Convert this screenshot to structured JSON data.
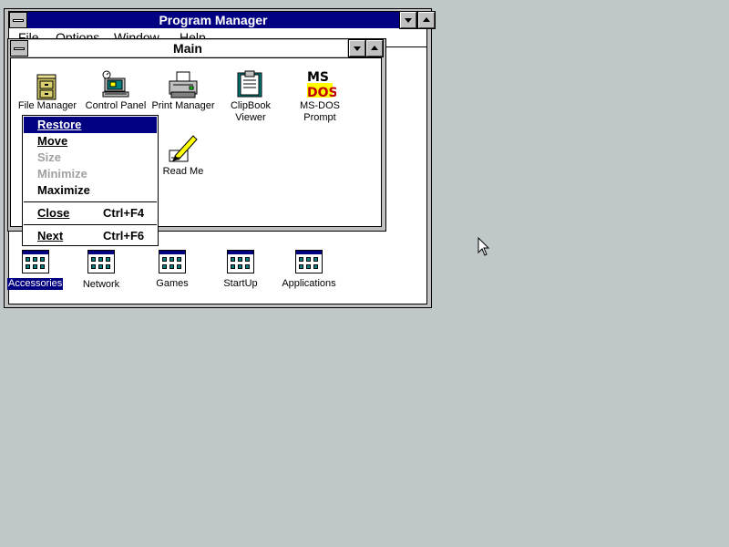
{
  "program_manager": {
    "title": "Program Manager",
    "menu": [
      "File",
      "Options",
      "Window",
      "Help"
    ]
  },
  "main_group": {
    "title": "Main",
    "icons": [
      {
        "label": "File Manager",
        "icon": "file-cabinet-icon"
      },
      {
        "label": "Control Panel",
        "icon": "control-panel-icon"
      },
      {
        "label": "Print Manager",
        "icon": "printer-icon"
      },
      {
        "label_line1": "ClipBook",
        "label_line2": "Viewer",
        "icon": "clipbook-icon"
      },
      {
        "label_line1": "MS-DOS",
        "label_line2": "Prompt",
        "icon": "ms-dos-icon"
      },
      {
        "label": "Read Me",
        "icon": "pen-paper-icon"
      }
    ]
  },
  "context_menu": {
    "items": [
      {
        "label": "Restore",
        "state": "highlighted"
      },
      {
        "label": "Move",
        "state": "enabled"
      },
      {
        "label": "Size",
        "state": "disabled"
      },
      {
        "label": "Minimize",
        "state": "disabled"
      },
      {
        "label": "Maximize",
        "state": "enabled"
      },
      {
        "label": "Close",
        "shortcut": "Ctrl+F4",
        "state": "enabled"
      },
      {
        "label": "Next",
        "shortcut": "Ctrl+F6",
        "state": "enabled"
      }
    ]
  },
  "group_icons": [
    {
      "label": "Accessories",
      "selected": true
    },
    {
      "label": "Network",
      "selected": false
    },
    {
      "label": "Games",
      "selected": false
    },
    {
      "label": "StartUp",
      "selected": false
    },
    {
      "label": "Applications",
      "selected": false
    }
  ],
  "colors": {
    "desktop": "#c0c7c8",
    "title_active": "#000080",
    "highlight": "#000080",
    "disabled_text": "#a0a0a0"
  }
}
